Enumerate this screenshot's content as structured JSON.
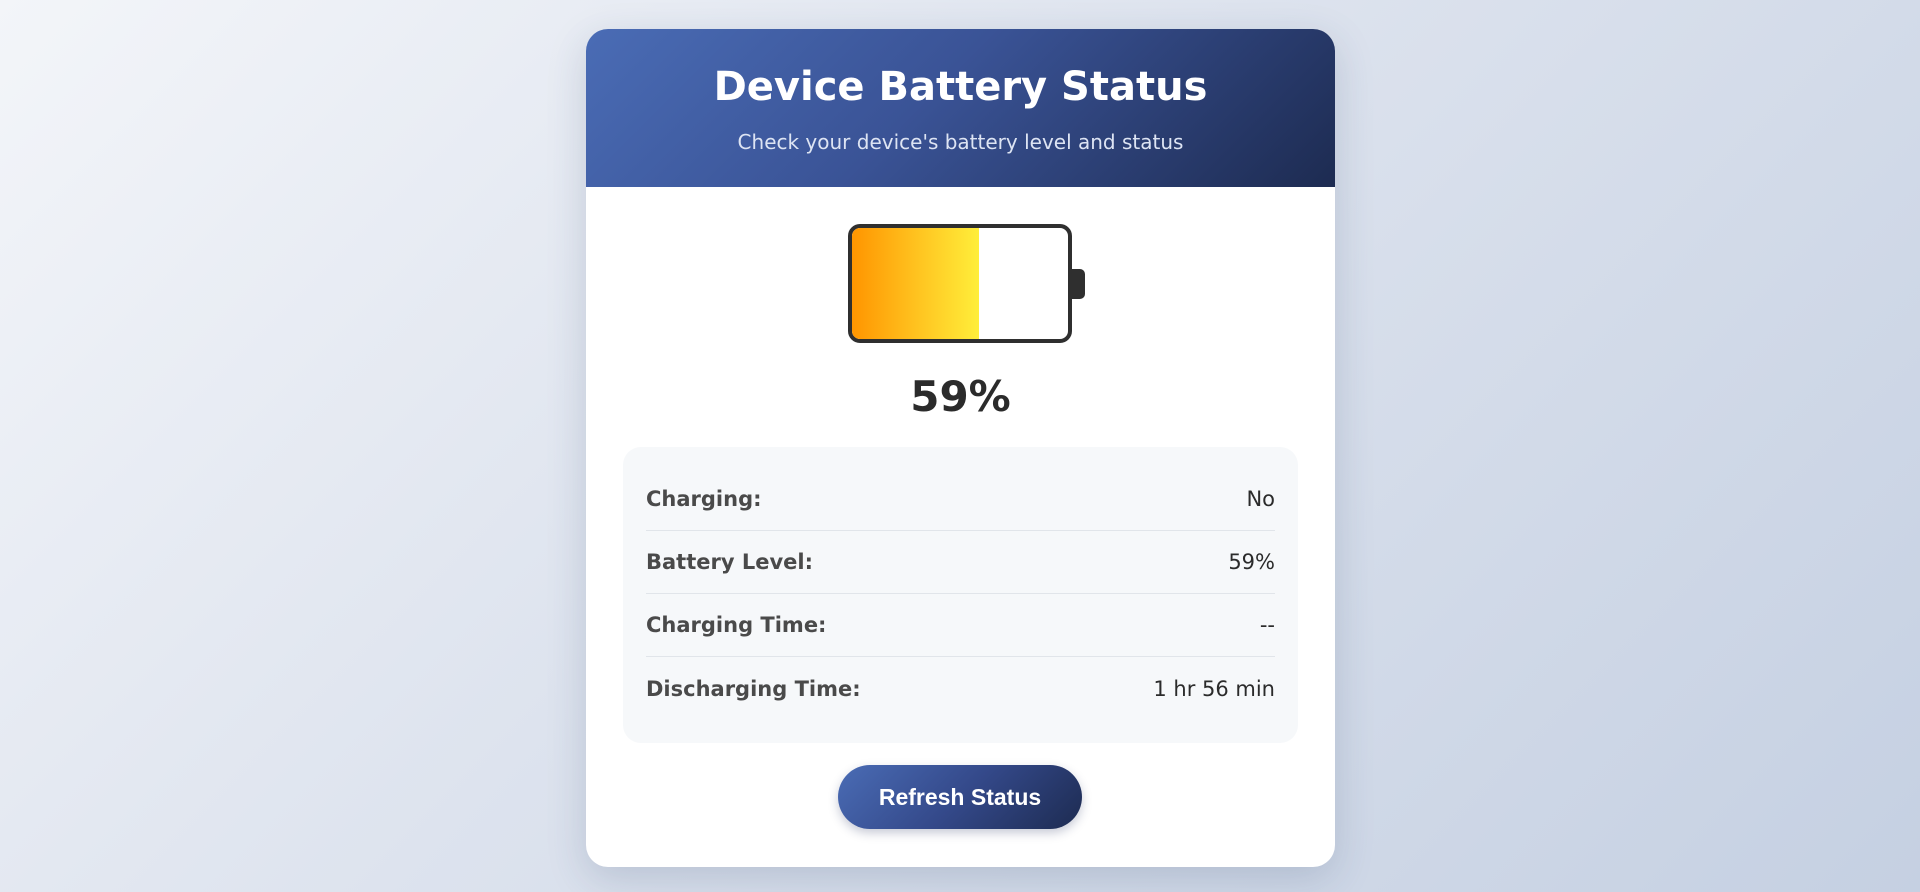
{
  "header": {
    "title": "Device Battery Status",
    "subtitle": "Check your device's battery level and status"
  },
  "battery": {
    "level_fraction": 0.59,
    "percent_label": "59%",
    "fill_gradient": [
      "#ff9500",
      "#ffee3a"
    ],
    "outline_color": "#2f2f2f"
  },
  "details": {
    "rows": [
      {
        "label": "Charging:",
        "value": "No"
      },
      {
        "label": "Battery Level:",
        "value": "59%"
      },
      {
        "label": "Charging Time:",
        "value": "--"
      },
      {
        "label": "Discharging Time:",
        "value": "1 hr 56 min"
      }
    ]
  },
  "actions": {
    "refresh_label": "Refresh Status"
  },
  "colors": {
    "accent_start": "#4a6cb5",
    "accent_end": "#1d2b51"
  }
}
